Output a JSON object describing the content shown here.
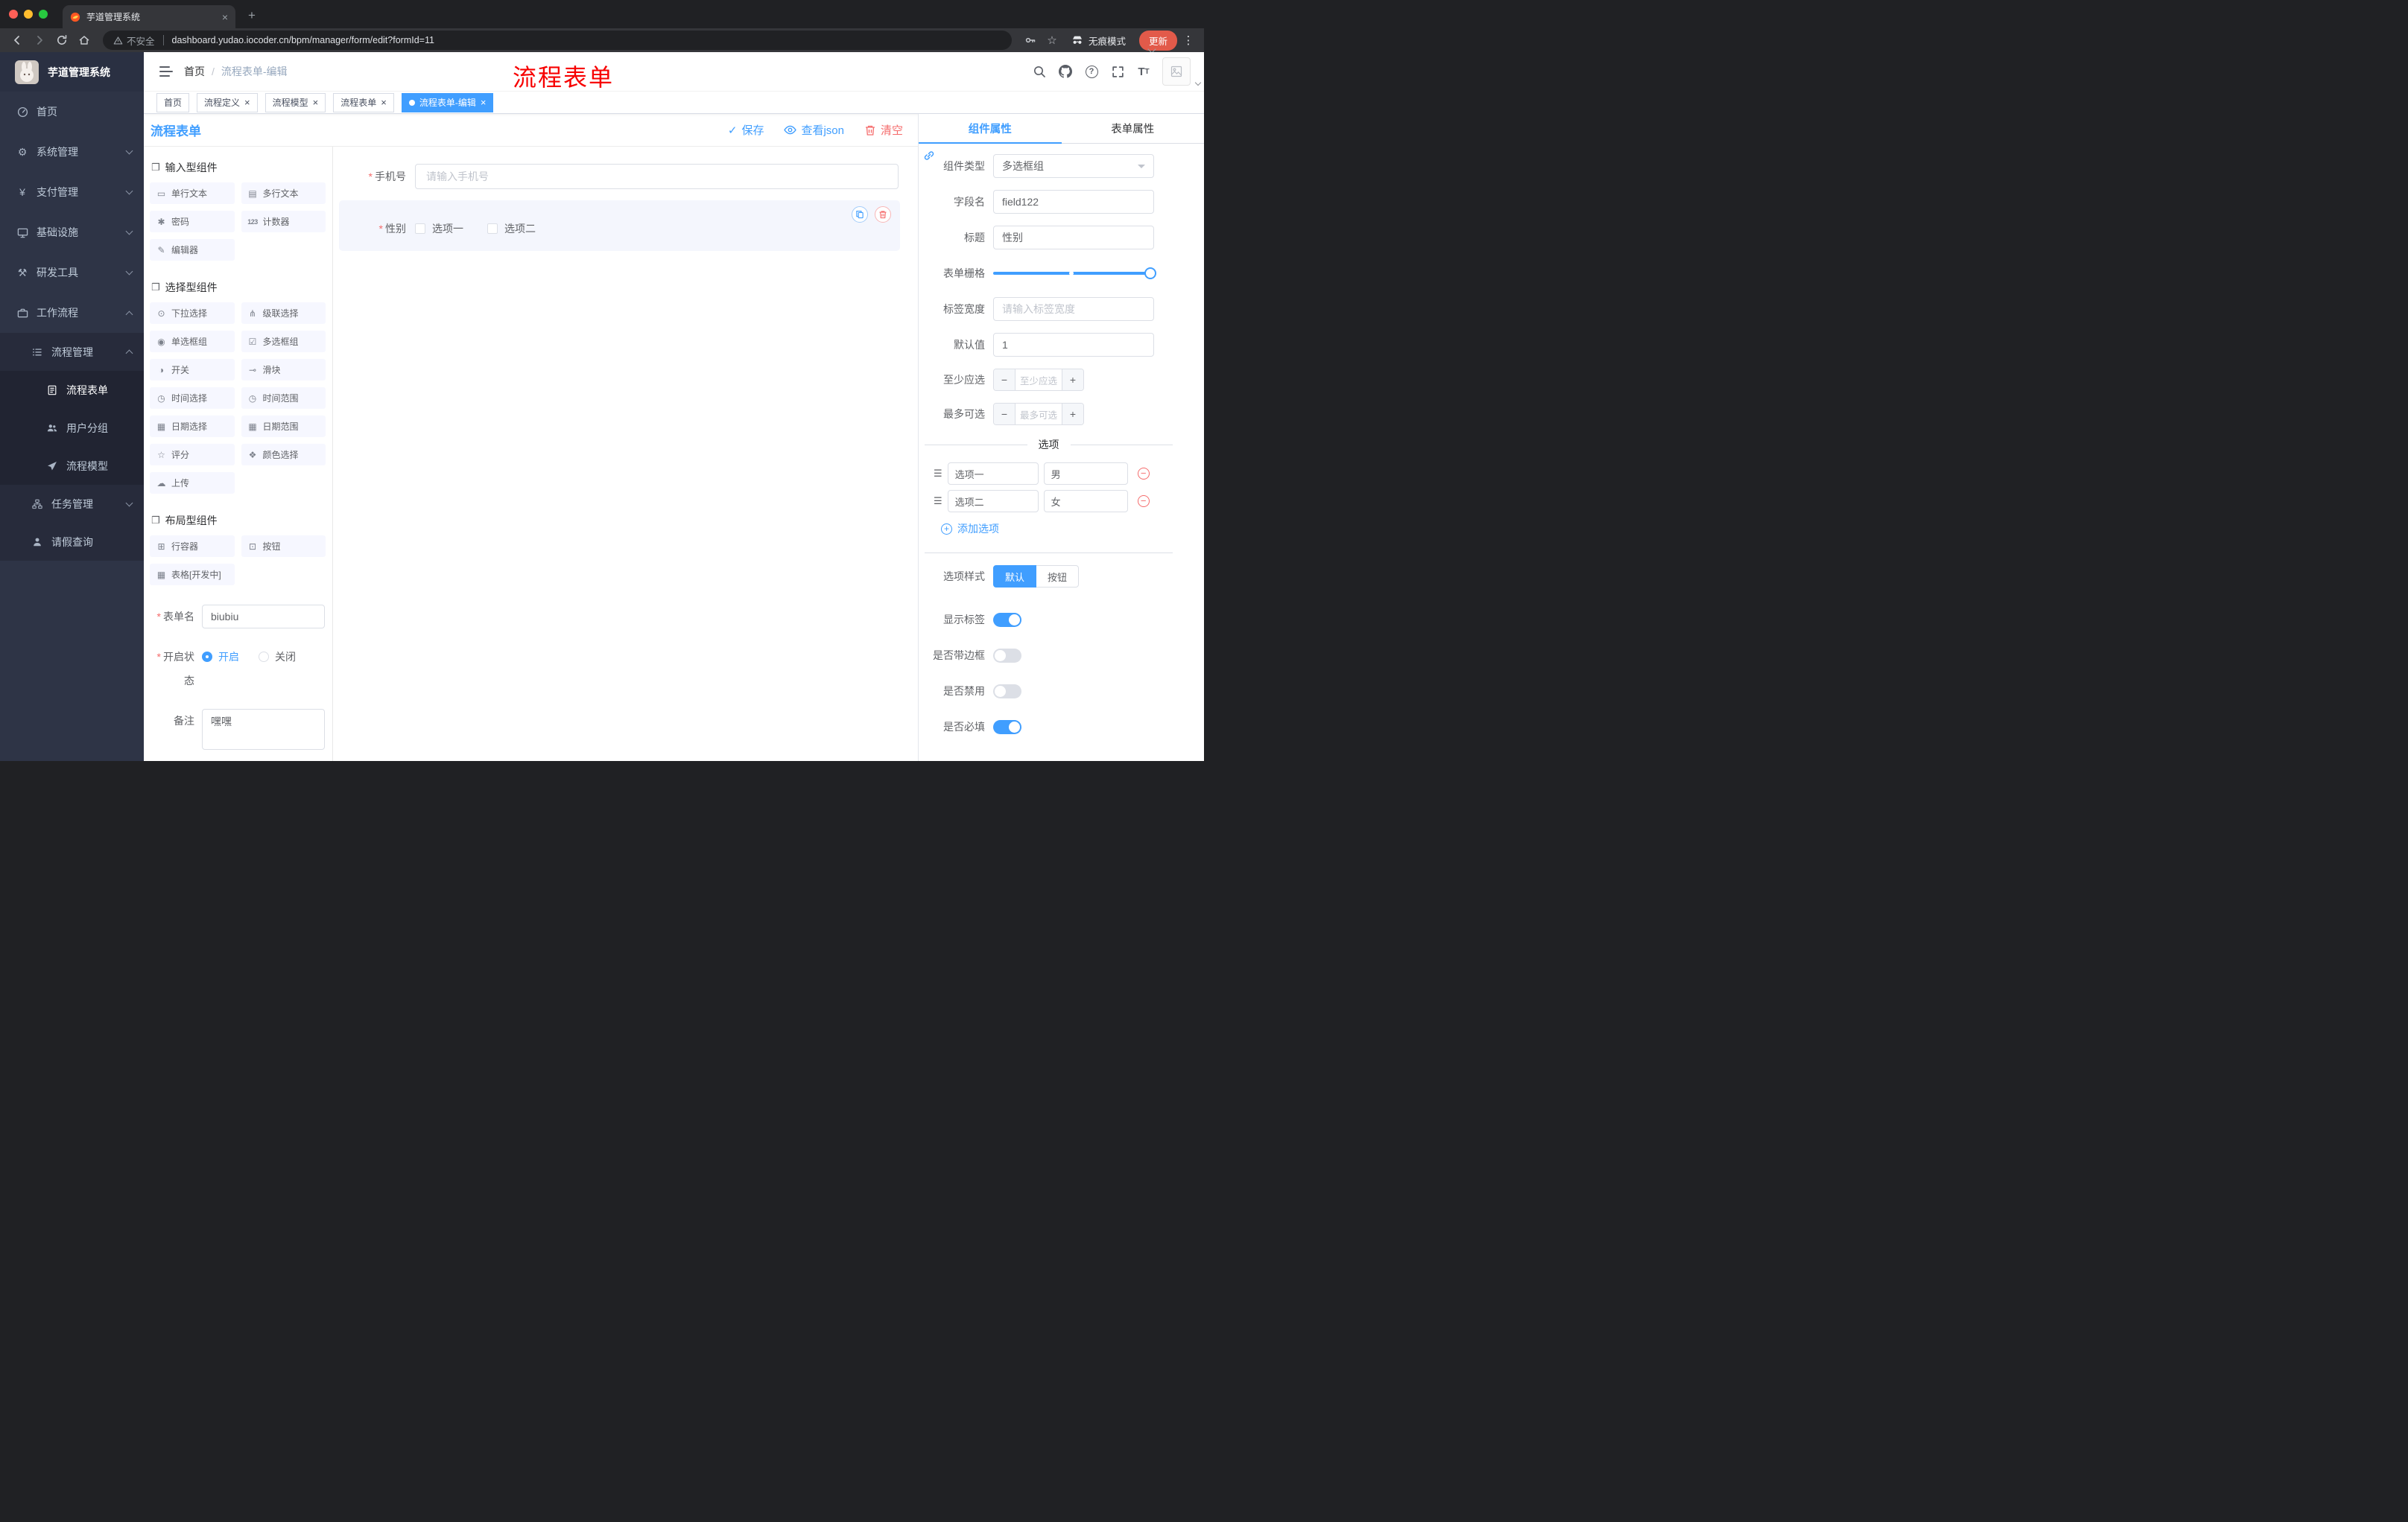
{
  "browser": {
    "tab_title": "芋道管理系统",
    "security_label": "不安全",
    "url": "dashboard.yudao.iocoder.cn/bpm/manager/form/edit?formId=11",
    "incognito_label": "无痕模式",
    "update_label": "更新"
  },
  "sidebar": {
    "app_title": "芋道管理系统",
    "items": [
      {
        "label": "首页"
      },
      {
        "label": "系统管理"
      },
      {
        "label": "支付管理"
      },
      {
        "label": "基础设施"
      },
      {
        "label": "研发工具"
      },
      {
        "label": "工作流程"
      },
      {
        "label": "流程管理"
      },
      {
        "label": "流程表单"
      },
      {
        "label": "用户分组"
      },
      {
        "label": "流程模型"
      },
      {
        "label": "任务管理"
      },
      {
        "label": "请假查询"
      }
    ]
  },
  "header": {
    "breadcrumb": {
      "home": "首页",
      "separator": "/",
      "current": "流程表单-编辑"
    },
    "annotation": "流程表单"
  },
  "tags": [
    {
      "label": "首页"
    },
    {
      "label": "流程定义"
    },
    {
      "label": "流程模型"
    },
    {
      "label": "流程表单"
    },
    {
      "label": "流程表单-编辑"
    }
  ],
  "designer": {
    "title": "流程表单",
    "actions": {
      "save": "保存",
      "view_json": "查看json",
      "clear": "清空"
    },
    "palette": {
      "groups": [
        {
          "title": "输入型组件",
          "items": [
            "单行文本",
            "多行文本",
            "密码",
            "计数器",
            "编辑器"
          ]
        },
        {
          "title": "选择型组件",
          "items": [
            "下拉选择",
            "级联选择",
            "单选框组",
            "多选框组",
            "开关",
            "滑块",
            "时间选择",
            "时间范围",
            "日期选择",
            "日期范围",
            "评分",
            "颜色选择",
            "上传"
          ]
        },
        {
          "title": "布局型组件",
          "items": [
            "行容器",
            "按钮",
            "表格[开发中]"
          ]
        }
      ]
    },
    "form_meta": {
      "name_label": "表单名",
      "name_value": "biubiu",
      "status_label": "开启状态",
      "status_on": "开启",
      "status_off": "关闭",
      "remark_label": "备注",
      "remark_value": "嘿嘿"
    },
    "canvas": {
      "phone_label": "手机号",
      "phone_placeholder": "请输入手机号",
      "gender_label": "性别",
      "gender_opt1": "选项一",
      "gender_opt2": "选项二"
    }
  },
  "properties": {
    "tabs": {
      "component": "组件属性",
      "form": "表单属性"
    },
    "component_type": {
      "label": "组件类型",
      "value": "多选框组"
    },
    "field_name": {
      "label": "字段名",
      "value": "field122"
    },
    "title": {
      "label": "标题",
      "value": "性别"
    },
    "grid": {
      "label": "表单栅格"
    },
    "label_width": {
      "label": "标签宽度",
      "placeholder": "请输入标签宽度"
    },
    "default": {
      "label": "默认值",
      "value": "1"
    },
    "min": {
      "label": "至少应选",
      "placeholder": "至少应选"
    },
    "max": {
      "label": "最多可选",
      "placeholder": "最多可选"
    },
    "options": {
      "divider": "选项",
      "rows": [
        {
          "label": "选项一",
          "value": "男"
        },
        {
          "label": "选项二",
          "value": "女"
        }
      ],
      "add": "添加选项"
    },
    "style": {
      "label": "选项样式",
      "default": "默认",
      "button": "按钮"
    },
    "switches": [
      {
        "label": "显示标签",
        "on": true
      },
      {
        "label": "是否带边框",
        "on": false
      },
      {
        "label": "是否禁用",
        "on": false
      },
      {
        "label": "是否必填",
        "on": true
      }
    ]
  },
  "icons": {
    "close": "×",
    "plus": "+",
    "minus": "−",
    "kebab": "⋮",
    "bookmark": "☆",
    "gear": "⚙",
    "yen": "¥",
    "tools": "⚒",
    "cube": "❒",
    "single_text": "▭",
    "multi_text": "▤",
    "password": "✱",
    "counter": "123",
    "editor": "✎",
    "select": "⊙",
    "cascader": "⋔",
    "radio_group": "◉",
    "checkbox_group": "☑",
    "switch": "◑",
    "slider": "⊸",
    "time": "◷",
    "time_range": "◷",
    "date": "▦",
    "date_range": "▦",
    "rate": "☆",
    "color": "❖",
    "upload": "☁",
    "row_container": "⊞",
    "button": "⊡",
    "table": "▦",
    "check": "✓",
    "drag": "☰",
    "asterisk": "*"
  },
  "colors": {
    "accent": "#409eff",
    "danger": "#f56c6c",
    "annotation": "#f70000"
  }
}
